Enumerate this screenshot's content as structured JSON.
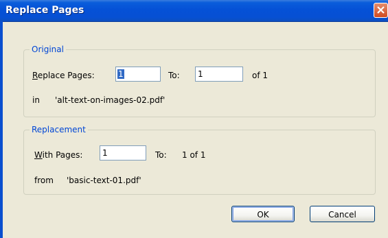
{
  "window": {
    "title": "Replace Pages"
  },
  "original": {
    "legend": "Original",
    "replace_label_underlined": "R",
    "replace_label_rest": "eplace Pages:",
    "from_page": "1",
    "to_label": "To:",
    "to_page": "1",
    "of_text": "of 1",
    "in_label": "in",
    "file": "'alt-text-on-images-02.pdf'"
  },
  "replacement": {
    "legend": "Replacement",
    "with_label_underlined": "W",
    "with_label_rest": "ith Pages:",
    "from_page": "1",
    "to_label": "To:",
    "to_value": "1 of 1",
    "from_label": "from",
    "file": "'basic-text-01.pdf'"
  },
  "buttons": {
    "ok": "OK",
    "cancel": "Cancel"
  },
  "colors": {
    "title_bar": "#0551d6",
    "legend": "#0046d5",
    "close": "#d04a20"
  }
}
